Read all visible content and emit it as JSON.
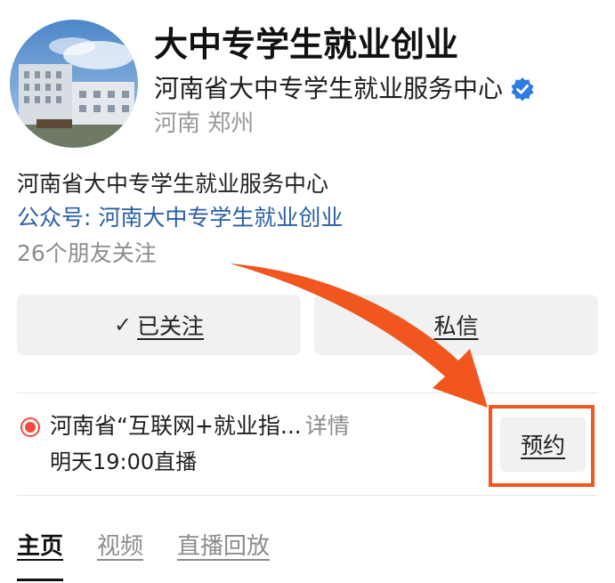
{
  "profile": {
    "name": "大中专学生就业创业",
    "org": "河南省大中专学生就业服务中心",
    "location": "河南 郑州",
    "verified_icon": "verified-icon"
  },
  "bio": {
    "description": "河南省大中专学生就业服务中心",
    "official_account": "公众号: 河南大中专学生就业创业",
    "friends_following": "26个朋友关注"
  },
  "actions": {
    "follow_check": "✓",
    "follow_label": "已关注",
    "message_label": "私信"
  },
  "live": {
    "title": "河南省“互联网+就业指...",
    "detail": "详情",
    "time": "明天19:00直播",
    "reserve_label": "预约"
  },
  "tabs": [
    {
      "label": "主页",
      "active": true
    },
    {
      "label": "视频",
      "active": false
    },
    {
      "label": "直播回放",
      "active": false
    }
  ],
  "colors": {
    "accent_orange": "#f0561e",
    "link_blue": "#2a5fa3",
    "verified_blue": "#2f7ce6",
    "live_red": "#f24a3c"
  }
}
